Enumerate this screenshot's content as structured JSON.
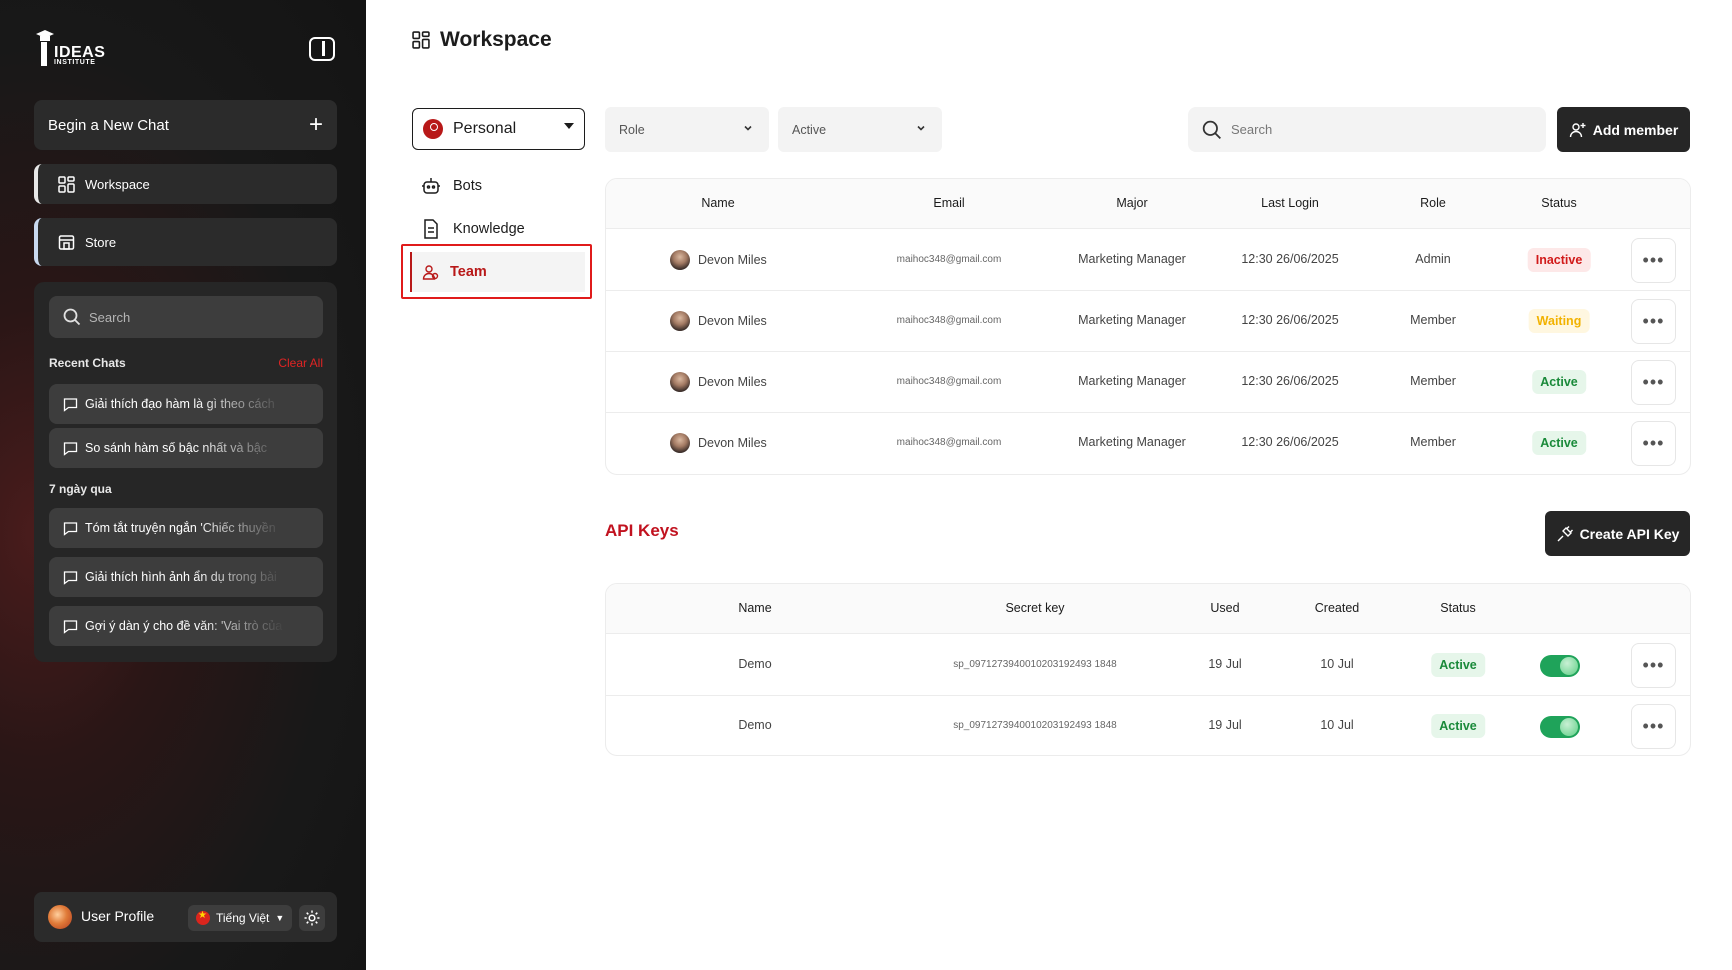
{
  "sidebar": {
    "logo_text": "IDEAS",
    "logo_sub": "INSTITUTE",
    "new_chat_label": "Begin a New Chat",
    "nav": [
      {
        "label": "Workspace"
      },
      {
        "label": "Store"
      }
    ],
    "search_placeholder": "Search",
    "recent_title": "Recent Chats",
    "clear_all": "Clear All",
    "recent_chats": [
      "Giải thích đạo hàm là gì theo cách",
      "So sánh hàm số bậc nhất và bậc"
    ],
    "group_label": "7 ngày qua",
    "week_chats": [
      "Tóm tắt truyện ngắn 'Chiếc thuyền",
      "Giải thích hình ảnh ẩn dụ trong bài",
      "Gợi ý dàn ý cho đề văn: 'Vai trò của"
    ],
    "profile_name": "User Profile",
    "language": "Tiếng Việt"
  },
  "main": {
    "title": "Workspace",
    "workspace_select": "Personal",
    "nav": [
      {
        "label": "Bots"
      },
      {
        "label": "Knowledge"
      },
      {
        "label": "Team"
      }
    ],
    "filters": {
      "role": "Role",
      "status": "Active"
    },
    "search_placeholder": "Search",
    "add_member": "Add member",
    "members_columns": [
      "Name",
      "Email",
      "Major",
      "Last Login",
      "Role",
      "Status"
    ],
    "members": [
      {
        "name": "Devon Miles",
        "email": "maihoc348@gmail.com",
        "major": "Marketing Manager",
        "last_login": "12:30 26/06/2025",
        "role": "Admin",
        "status": "Inactive"
      },
      {
        "name": "Devon Miles",
        "email": "maihoc348@gmail.com",
        "major": "Marketing Manager",
        "last_login": "12:30 26/06/2025",
        "role": "Member",
        "status": "Waiting"
      },
      {
        "name": "Devon Miles",
        "email": "maihoc348@gmail.com",
        "major": "Marketing Manager",
        "last_login": "12:30 26/06/2025",
        "role": "Member",
        "status": "Active"
      },
      {
        "name": "Devon Miles",
        "email": "maihoc348@gmail.com",
        "major": "Marketing Manager",
        "last_login": "12:30 26/06/2025",
        "role": "Member",
        "status": "Active"
      }
    ],
    "api_title": "API Keys",
    "create_api_key": "Create API Key",
    "keys_columns": [
      "Name",
      "Secret key",
      "Used",
      "Created",
      "Status"
    ],
    "keys": [
      {
        "name": "Demo",
        "secret": "sp_0971273940010203192493 1848",
        "used": "19 Jul",
        "created": "10 Jul",
        "status": "Active",
        "enabled": true
      },
      {
        "name": "Demo",
        "secret": "sp_0971273940010203192493 1848",
        "used": "19 Jul",
        "created": "10 Jul",
        "status": "Active",
        "enabled": true
      }
    ],
    "more_glyph": "•••"
  },
  "colors": {
    "accent_red": "#c1121f",
    "active_green": "#1a8a3a",
    "waiting_yellow": "#f2b200",
    "inactive_red": "#d11a1a",
    "highlight_box": "#e01b1b"
  }
}
